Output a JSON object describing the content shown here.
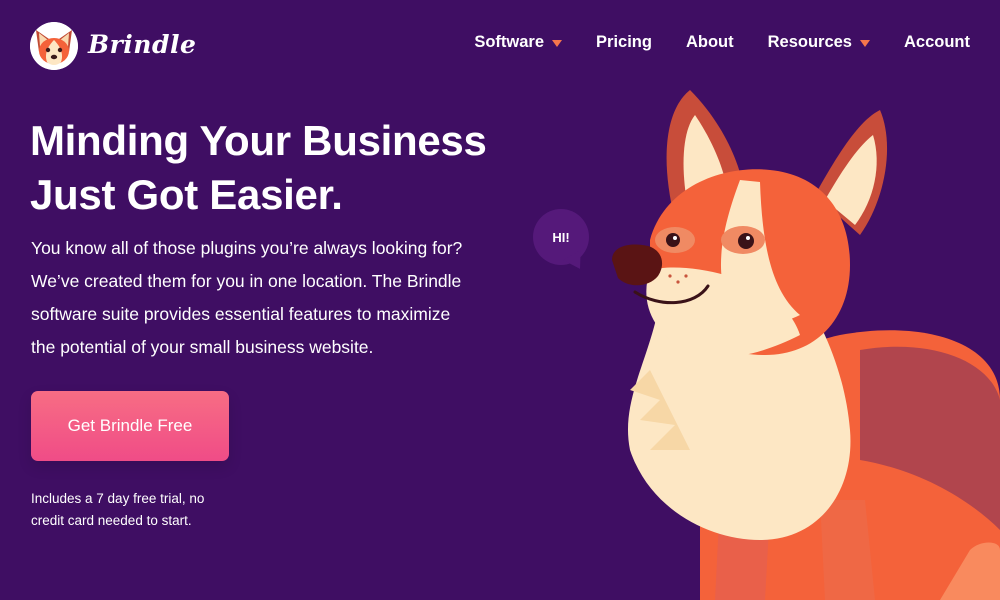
{
  "brand": {
    "name": "Brindle"
  },
  "nav": {
    "items": [
      {
        "label": "Software",
        "has_dropdown": true
      },
      {
        "label": "Pricing",
        "has_dropdown": false
      },
      {
        "label": "About",
        "has_dropdown": false
      },
      {
        "label": "Resources",
        "has_dropdown": true
      },
      {
        "label": "Account",
        "has_dropdown": false
      }
    ]
  },
  "hero": {
    "title_line1": "Minding Your Business",
    "title_line2": "Just Got Easier.",
    "body_line1": "You know all of those plugins you’re always looking for?",
    "body_line2": "We’ve created them for you in one location. The Brindle",
    "body_line3": "software suite provides essential features to maximize",
    "body_line4": "the potential of your small business website.",
    "cta_label": "Get Brindle Free",
    "footnote_line1": "Includes a 7 day free trial, no",
    "footnote_line2": "credit card needed to start."
  },
  "illustration": {
    "speech_bubble": "HI!"
  },
  "colors": {
    "background": "#3f0e63",
    "accent_caret": "#f6764c",
    "cta_gradient_top": "#f76d84",
    "cta_gradient_bottom": "#f04c87",
    "corgi_orange": "#f4623a",
    "corgi_cream": "#fde7c4"
  },
  "icons": {
    "logo": "corgi-logo-icon",
    "dropdown": "caret-down-icon"
  }
}
